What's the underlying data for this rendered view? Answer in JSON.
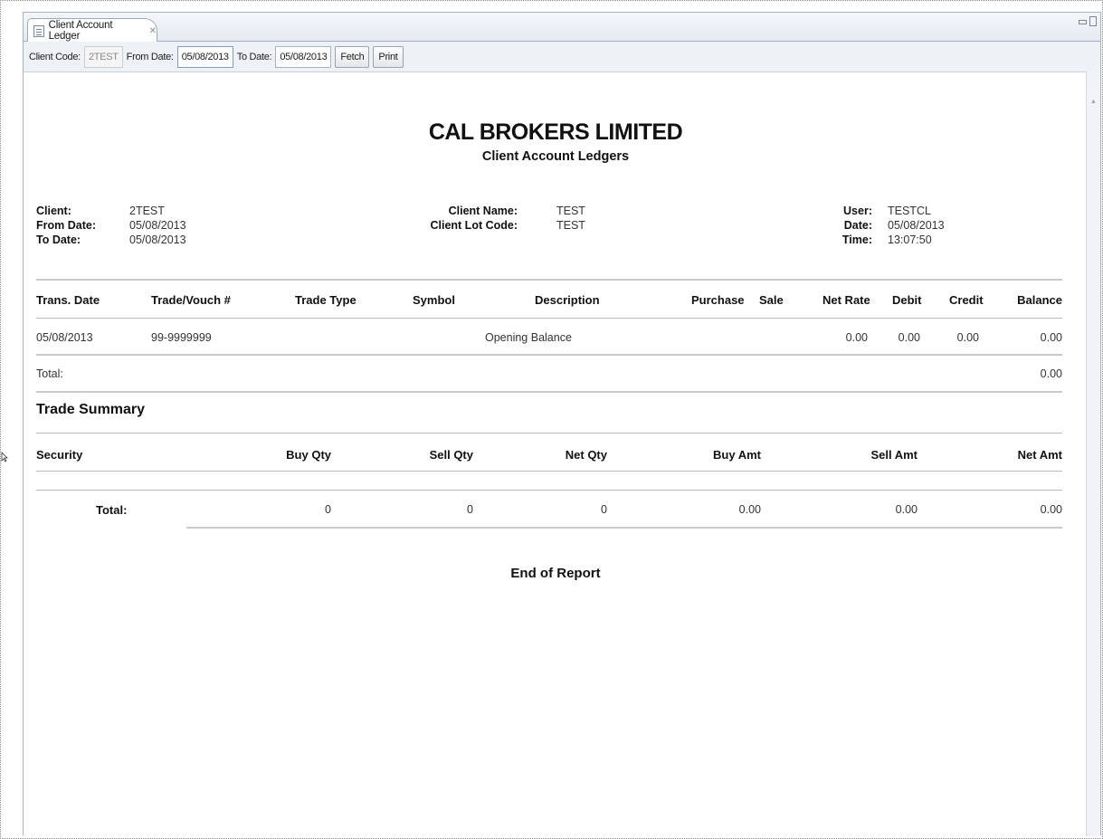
{
  "tab": {
    "title": "Client Account Ledger",
    "close_glyph": "✕"
  },
  "toolbar": {
    "client_code_label": "Client Code:",
    "client_code_value": "2TEST",
    "from_date_label": "From Date:",
    "from_date_value": "05/08/2013",
    "to_date_label": "To Date:",
    "to_date_value": "05/08/2013",
    "fetch_label": "Fetch",
    "print_label": "Print"
  },
  "report": {
    "company": "CAL BROKERS LIMITED",
    "title": "Client Account Ledgers",
    "meta": {
      "client_label": "Client:",
      "client_value": "2TEST",
      "from_date_label": "From Date:",
      "from_date_value": "05/08/2013",
      "to_date_label": "To Date:",
      "to_date_value": "05/08/2013",
      "client_name_label": "Client Name:",
      "client_name_value": "TEST",
      "client_lot_code_label": "Client Lot Code:",
      "client_lot_code_value": "TEST",
      "user_label": "User:",
      "user_value": "TESTCL",
      "date_label": "Date:",
      "date_value": "05/08/2013",
      "time_label": "Time:",
      "time_value": "13:07:50"
    },
    "ledger_columns": {
      "trans_date": "Trans. Date",
      "trade_vouch": "Trade/Vouch #",
      "trade_type": "Trade Type",
      "symbol": "Symbol",
      "description": "Description",
      "purchase": "Purchase",
      "sale": "Sale",
      "net_rate": "Net Rate",
      "debit": "Debit",
      "credit": "Credit",
      "balance": "Balance"
    },
    "ledger_rows": [
      {
        "trans_date": "05/08/2013",
        "trade_vouch": "99-9999999",
        "description": "Opening Balance",
        "net_rate": "0.00",
        "debit": "0.00",
        "credit": "0.00",
        "balance": "0.00"
      }
    ],
    "ledger_total": {
      "label": "Total:",
      "balance": "0.00"
    },
    "trade_summary": {
      "title": "Trade Summary",
      "columns": {
        "security": "Security",
        "buy_qty": "Buy Qty",
        "sell_qty": "Sell Qty",
        "net_qty": "Net Qty",
        "buy_amt": "Buy Amt",
        "sell_amt": "Sell Amt",
        "net_amt": "Net Amt"
      },
      "total": {
        "label": "Total:",
        "buy_qty": "0",
        "sell_qty": "0",
        "net_qty": "0",
        "buy_amt": "0.00",
        "sell_amt": "0.00",
        "net_amt": "0.00"
      }
    },
    "end_text": "End of Report"
  }
}
